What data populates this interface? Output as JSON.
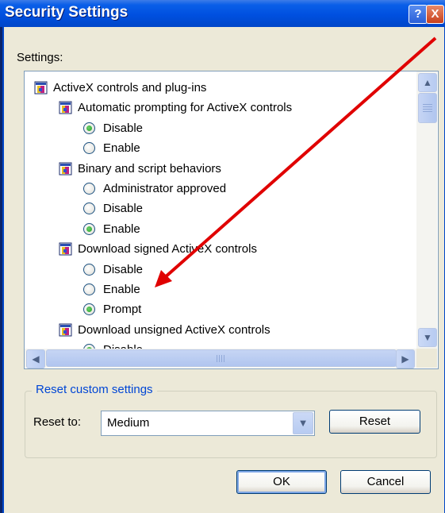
{
  "window": {
    "title": "Security Settings",
    "help_symbol": "?",
    "close_symbol": "X"
  },
  "settings_label": "Settings:",
  "tree": {
    "items": [
      {
        "kind": "category",
        "label": "ActiveX controls and plug-ins"
      },
      {
        "kind": "setting",
        "label": "Automatic prompting for ActiveX controls"
      },
      {
        "kind": "option",
        "label": "Disable",
        "checked": true
      },
      {
        "kind": "option",
        "label": "Enable",
        "checked": false
      },
      {
        "kind": "setting",
        "label": "Binary and script behaviors"
      },
      {
        "kind": "option",
        "label": "Administrator approved",
        "checked": false
      },
      {
        "kind": "option",
        "label": "Disable",
        "checked": false
      },
      {
        "kind": "option",
        "label": "Enable",
        "checked": true
      },
      {
        "kind": "setting",
        "label": "Download signed ActiveX controls"
      },
      {
        "kind": "option",
        "label": "Disable",
        "checked": false
      },
      {
        "kind": "option",
        "label": "Enable",
        "checked": false
      },
      {
        "kind": "option",
        "label": "Prompt",
        "checked": true
      },
      {
        "kind": "setting",
        "label": "Download unsigned ActiveX controls"
      },
      {
        "kind": "option",
        "label": "Disable",
        "checked": true
      }
    ]
  },
  "reset_group": {
    "title": "Reset custom settings",
    "reset_to_label": "Reset to:",
    "selected_level": "Medium",
    "reset_button": "Reset"
  },
  "footer": {
    "ok_button": "OK",
    "cancel_button": "Cancel"
  },
  "colors": {
    "annotation_arrow": "#e00000",
    "group_title": "#0046d5"
  }
}
